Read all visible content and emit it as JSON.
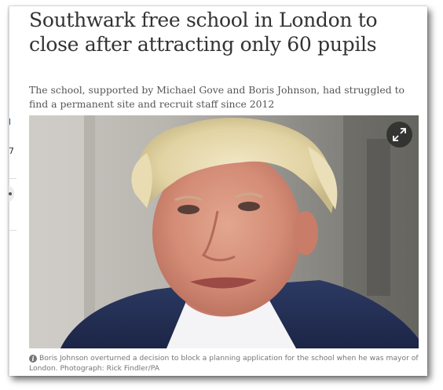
{
  "article": {
    "headline": "Southwark free school in London to close after attracting only 60 pupils",
    "standfirst": "The school, supported by Michael Gove and Boris Johnson, had struggled to find a permanent site and recruit staff since 2012",
    "image": {
      "alt": "Boris Johnson",
      "expand_icon": "expand-arrows-icon"
    },
    "caption": {
      "icon": "info-icon",
      "icon_glyph": "i",
      "text": "Boris Johnson overturned a decision to block a planning application for the school when he was mayor of London. Photograph: Rick Findler/PA"
    }
  },
  "left_rail": {
    "marks": [
      "l",
      "7"
    ],
    "dot_icon": "bullet-icon"
  },
  "colors": {
    "headline": "#333333",
    "standfirst": "#555555",
    "caption": "#767676",
    "link_blue": "#005689"
  }
}
